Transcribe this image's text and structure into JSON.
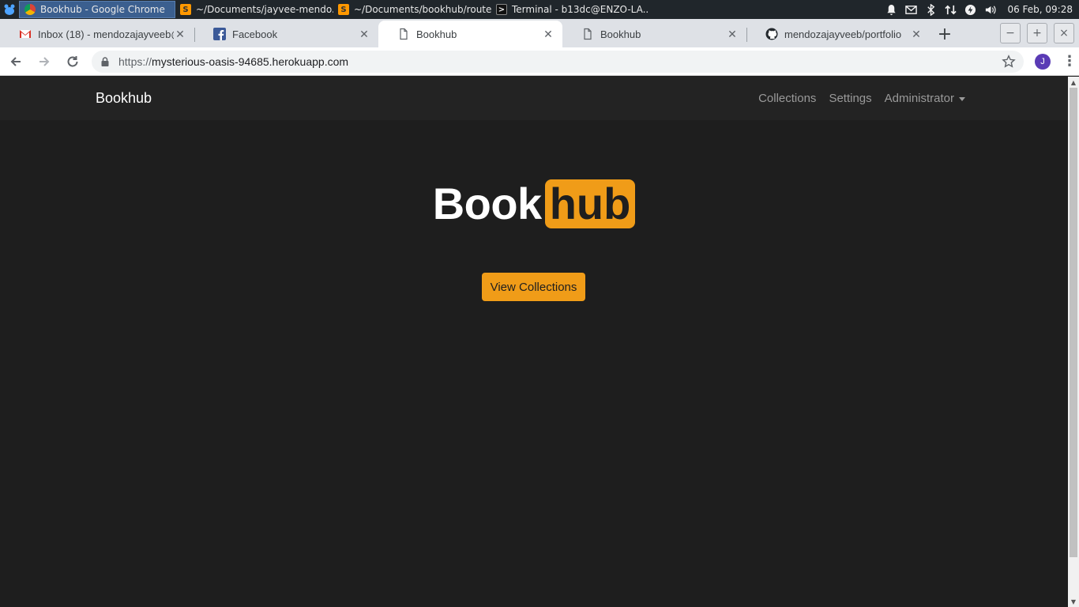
{
  "taskbar": {
    "tasks": [
      {
        "label": "Bookhub - Google Chrome",
        "icon": "chrome-icon"
      },
      {
        "label": "~/Documents/jayvee-mendo...",
        "icon": "sublime-icon"
      },
      {
        "label": "~/Documents/bookhub/route...",
        "icon": "sublime-icon"
      },
      {
        "label": "Terminal - b13dc@ENZO-LA...",
        "icon": "terminal-icon"
      }
    ],
    "clock": "06 Feb, 09:28"
  },
  "tabs": [
    {
      "title": "Inbox (18) - mendozajayveeb@",
      "icon": "gmail-icon"
    },
    {
      "title": "Facebook",
      "icon": "facebook-icon"
    },
    {
      "title": "Bookhub",
      "icon": "page-icon"
    },
    {
      "title": "Bookhub",
      "icon": "page-icon"
    },
    {
      "title": "mendozajayveeb/portfolio",
      "icon": "github-icon"
    }
  ],
  "new_tab": "+",
  "window_controls": {
    "minimize": "−",
    "maximize": "+",
    "close": "×"
  },
  "address": {
    "scheme": "https://",
    "host": "mysterious-oasis-94685.herokuapp.com"
  },
  "profile_initial": "J",
  "site": {
    "brand": "Bookhub",
    "nav": {
      "collections": "Collections",
      "settings": "Settings",
      "admin": "Administrator"
    },
    "logo_part1": "Book",
    "logo_part2": "hub",
    "cta": "View Collections"
  },
  "colors": {
    "accent": "#f09c18",
    "page_bg": "#1e1e1e",
    "navbar_bg": "#232323"
  }
}
